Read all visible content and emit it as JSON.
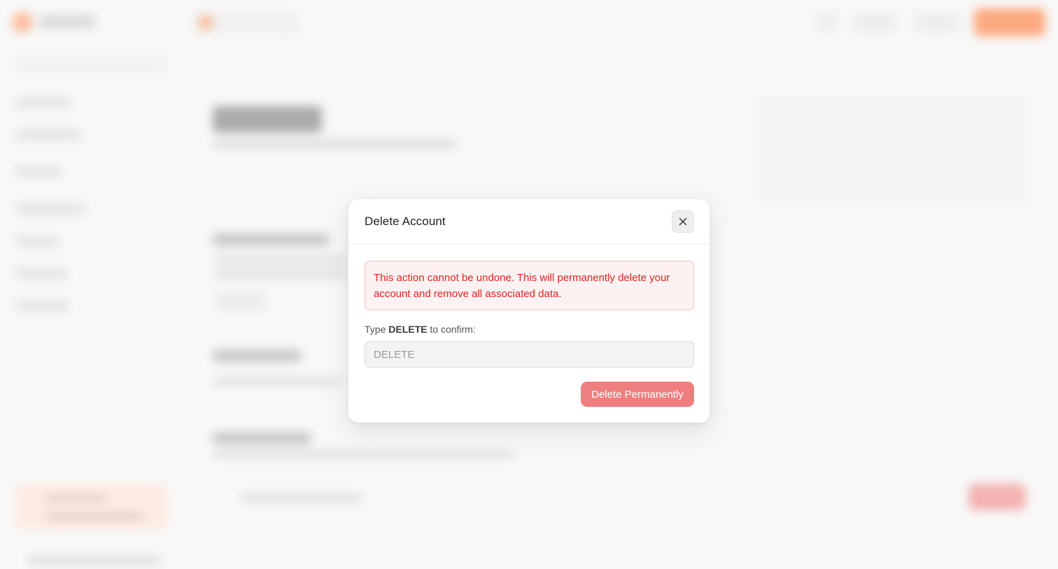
{
  "modal": {
    "title": "Delete Account",
    "close_icon": "close-icon",
    "warning_text": "This action cannot be undone. This will permanently delete your account and remove all associated data.",
    "confirm_label_prefix": "Type ",
    "confirm_keyword": "DELETE",
    "confirm_label_suffix": " to confirm:",
    "input_value": "",
    "input_placeholder": "DELETE",
    "delete_button_label": "Delete Permanently"
  },
  "colors": {
    "danger_text": "#e02424",
    "danger_bg": "#fdf1f1",
    "danger_button": "#ef7f7f",
    "brand_accent": "#ff6a1f"
  }
}
